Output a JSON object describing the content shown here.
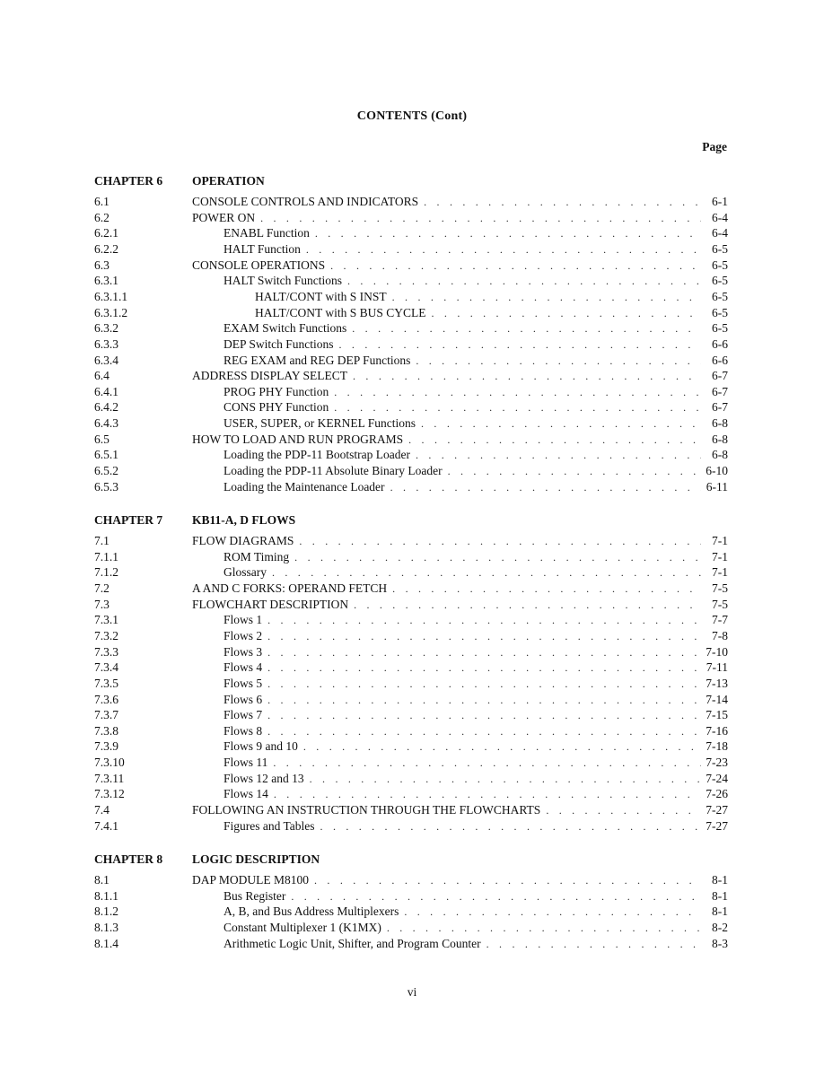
{
  "title": "CONTENTS (Cont)",
  "page_column_header": "Page",
  "chapters": [
    {
      "number": "CHAPTER 6",
      "title": "OPERATION",
      "entries": [
        {
          "num": "6.1",
          "label": "CONSOLE CONTROLS AND INDICATORS",
          "page": "6-1",
          "level": 0
        },
        {
          "num": "6.2",
          "label": "POWER ON",
          "page": "6-4",
          "level": 0
        },
        {
          "num": "6.2.1",
          "label": "ENABL Function",
          "page": "6-4",
          "level": 1
        },
        {
          "num": "6.2.2",
          "label": "HALT Function",
          "page": "6-5",
          "level": 1
        },
        {
          "num": "6.3",
          "label": "CONSOLE OPERATIONS",
          "page": "6-5",
          "level": 0
        },
        {
          "num": "6.3.1",
          "label": "HALT Switch Functions",
          "page": "6-5",
          "level": 1
        },
        {
          "num": "6.3.1.1",
          "label": "HALT/CONT with S INST",
          "page": "6-5",
          "level": 2
        },
        {
          "num": "6.3.1.2",
          "label": "HALT/CONT with S BUS CYCLE",
          "page": "6-5",
          "level": 2
        },
        {
          "num": "6.3.2",
          "label": "EXAM Switch Functions",
          "page": "6-5",
          "level": 1
        },
        {
          "num": "6.3.3",
          "label": "DEP Switch Functions",
          "page": "6-6",
          "level": 1
        },
        {
          "num": "6.3.4",
          "label": "REG EXAM and REG DEP Functions",
          "page": "6-6",
          "level": 1
        },
        {
          "num": "6.4",
          "label": "ADDRESS DISPLAY SELECT",
          "page": "6-7",
          "level": 0
        },
        {
          "num": "6.4.1",
          "label": "PROG PHY Function",
          "page": "6-7",
          "level": 1
        },
        {
          "num": "6.4.2",
          "label": "CONS PHY Function",
          "page": "6-7",
          "level": 1
        },
        {
          "num": "6.4.3",
          "label": "USER, SUPER, or KERNEL Functions",
          "page": "6-8",
          "level": 1
        },
        {
          "num": "6.5",
          "label": "HOW TO LOAD AND RUN PROGRAMS",
          "page": "6-8",
          "level": 0
        },
        {
          "num": "6.5.1",
          "label": "Loading the PDP-11 Bootstrap Loader",
          "page": "6-8",
          "level": 1
        },
        {
          "num": "6.5.2",
          "label": "Loading the PDP-11 Absolute Binary Loader",
          "page": "6-10",
          "level": 1
        },
        {
          "num": "6.5.3",
          "label": "Loading the Maintenance Loader",
          "page": "6-11",
          "level": 1
        }
      ]
    },
    {
      "number": "CHAPTER 7",
      "title": "KB11-A, D FLOWS",
      "entries": [
        {
          "num": "7.1",
          "label": "FLOW DIAGRAMS",
          "page": "7-1",
          "level": 0
        },
        {
          "num": "7.1.1",
          "label": "ROM Timing",
          "page": "7-1",
          "level": 1
        },
        {
          "num": "7.1.2",
          "label": "Glossary",
          "page": "7-1",
          "level": 1
        },
        {
          "num": "7.2",
          "label": "A AND C FORKS: OPERAND FETCH",
          "page": "7-5",
          "level": 0
        },
        {
          "num": "7.3",
          "label": "FLOWCHART DESCRIPTION",
          "page": "7-5",
          "level": 0
        },
        {
          "num": "7.3.1",
          "label": "Flows 1",
          "page": "7-7",
          "level": 1
        },
        {
          "num": "7.3.2",
          "label": "Flows 2",
          "page": "7-8",
          "level": 1
        },
        {
          "num": "7.3.3",
          "label": "Flows 3",
          "page": "7-10",
          "level": 1
        },
        {
          "num": "7.3.4",
          "label": "Flows 4",
          "page": "7-11",
          "level": 1
        },
        {
          "num": "7.3.5",
          "label": "Flows 5",
          "page": "7-13",
          "level": 1
        },
        {
          "num": "7.3.6",
          "label": "Flows 6",
          "page": "7-14",
          "level": 1
        },
        {
          "num": "7.3.7",
          "label": "Flows 7",
          "page": "7-15",
          "level": 1
        },
        {
          "num": "7.3.8",
          "label": "Flows 8",
          "page": "7-16",
          "level": 1
        },
        {
          "num": "7.3.9",
          "label": "Flows 9 and 10",
          "page": "7-18",
          "level": 1
        },
        {
          "num": "7.3.10",
          "label": "Flows 11",
          "page": "7-23",
          "level": 1
        },
        {
          "num": "7.3.11",
          "label": "Flows 12 and 13",
          "page": "7-24",
          "level": 1
        },
        {
          "num": "7.3.12",
          "label": "Flows 14",
          "page": "7-26",
          "level": 1
        },
        {
          "num": "7.4",
          "label": "FOLLOWING AN INSTRUCTION THROUGH THE FLOWCHARTS",
          "page": "7-27",
          "level": 0
        },
        {
          "num": "7.4.1",
          "label": "Figures and Tables",
          "page": "7-27",
          "level": 1
        }
      ]
    },
    {
      "number": "CHAPTER 8",
      "title": "LOGIC DESCRIPTION",
      "entries": [
        {
          "num": "8.1",
          "label": "DAP MODULE M8100",
          "page": "8-1",
          "level": 0
        },
        {
          "num": "8.1.1",
          "label": "Bus Register",
          "page": "8-1",
          "level": 1
        },
        {
          "num": "8.1.2",
          "label": "A, B, and Bus Address Multiplexers",
          "page": "8-1",
          "level": 1
        },
        {
          "num": "8.1.3",
          "label": "Constant Multiplexer 1 (K1MX)",
          "page": "8-2",
          "level": 1
        },
        {
          "num": "8.1.4",
          "label": "Arithmetic Logic Unit, Shifter, and Program Counter",
          "page": "8-3",
          "level": 1
        }
      ]
    }
  ],
  "folio": "vi"
}
